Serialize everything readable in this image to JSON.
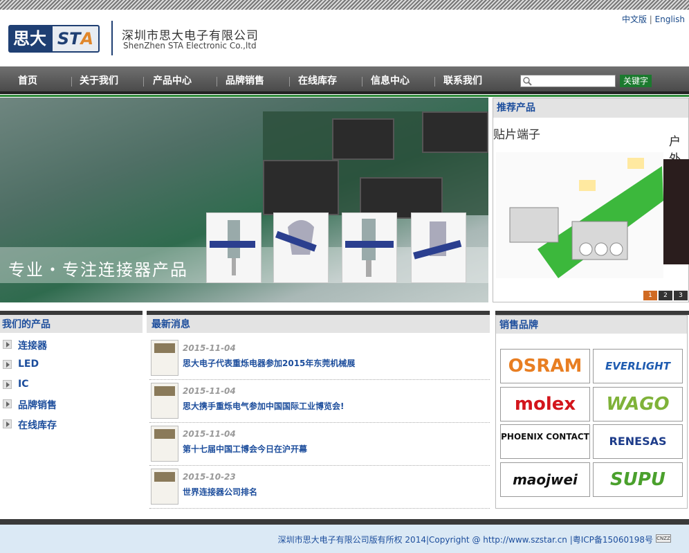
{
  "header": {
    "lang_cn": "中文版",
    "lang_sep": "|",
    "lang_en": "English",
    "logo_cn": "思大",
    "logo_en_1": "ST",
    "logo_en_2": "A",
    "company_cn": "深圳市思大电子有限公司",
    "company_en": "ShenZhen STA Electronic Co.,ltd"
  },
  "nav": {
    "items": [
      "首页",
      "关于我们",
      "产品中心",
      "品牌销售",
      "在线库存",
      "信息中心",
      "联系我们"
    ],
    "search_placeholder": "",
    "search_button": "关键字"
  },
  "banner": {
    "slogan": "专业・专注连接器产品",
    "pages": [
      "1",
      "2",
      "3"
    ],
    "active_page": 1
  },
  "recommended": {
    "heading": "推荐产品",
    "product_1": "贴片端子",
    "product_2": "户外"
  },
  "products": {
    "heading": "我们的产品",
    "items": [
      "连接器",
      "LED",
      "IC",
      "品牌销售",
      "在线库存"
    ]
  },
  "news": {
    "heading": "最新消息",
    "items": [
      {
        "date": "2015-11-04",
        "title": "思大电子代表重烁电器参加2015年东莞机械展"
      },
      {
        "date": "2015-11-04",
        "title": "思大携手重烁电气参加中国国际工业博览会!"
      },
      {
        "date": "2015-11-04",
        "title": "第十七届中国工博会今日在沪开幕"
      },
      {
        "date": "2015-10-23",
        "title": "世界连接器公司排名"
      }
    ]
  },
  "brands": {
    "heading": "销售品牌",
    "items": [
      "OSRAM",
      "EVERLIGHT",
      "molex",
      "WAGO",
      "PHOENIX CONTACT",
      "RENESAS",
      "maojwei",
      "SUPU"
    ],
    "colors": [
      "#e87e22",
      "#1e5bb0",
      "#d3151c",
      "#7fb239",
      "#111111",
      "#1d3c8a",
      "#111111",
      "#4aa02c"
    ]
  },
  "footer": {
    "text": "深圳市思大电子有限公司版有所权 2014|Copyright @ http://www.szstar.cn |粤ICP备15060198号",
    "badge": "CNZZ"
  }
}
